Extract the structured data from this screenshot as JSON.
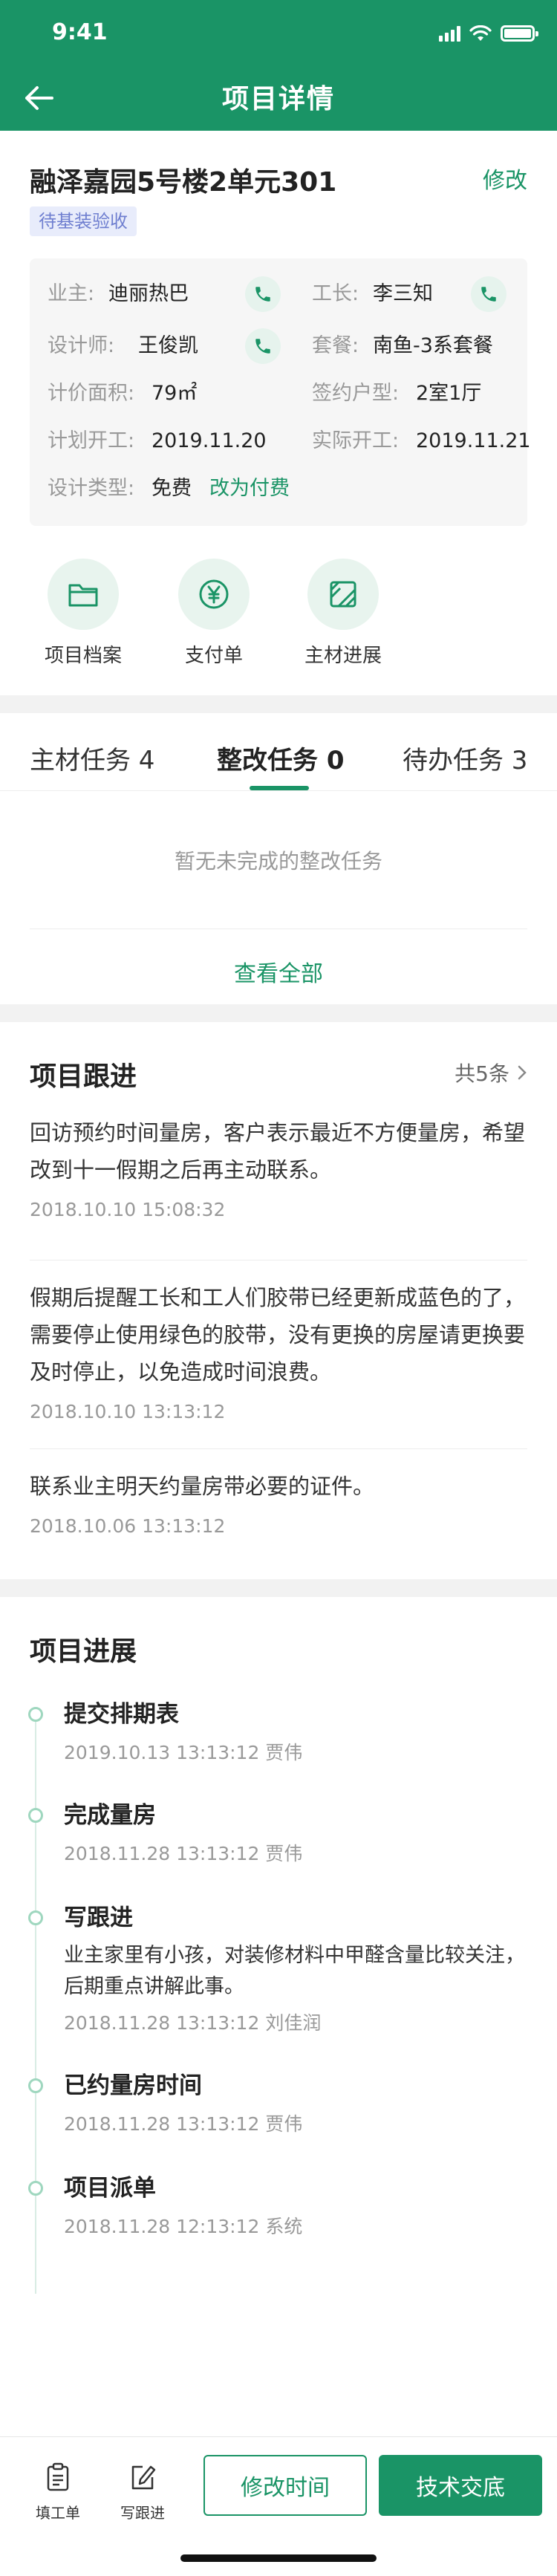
{
  "status_bar": {
    "time": "9:41"
  },
  "nav": {
    "title": "项目详情"
  },
  "project": {
    "name": "融泽嘉园5号楼2单元301",
    "edit_label": "修改",
    "status_tag": "待基装验收",
    "details": {
      "owner_label": "业主:",
      "owner_value": "迪丽热巴",
      "foreman_label": "工长:",
      "foreman_value": "李三知",
      "designer_label": "设计师:",
      "designer_value": "王俊凯",
      "package_label": "套餐:",
      "package_value": "南鱼-3系套餐",
      "area_label": "计价面积:",
      "area_value": "79㎡",
      "layout_label": "签约户型:",
      "layout_value": "2室1厅",
      "planned_start_label": "计划开工:",
      "planned_start_value": "2019.11.20",
      "actual_start_label": "实际开工:",
      "actual_start_value": "2019.11.21",
      "design_type_label": "设计类型:",
      "design_type_value": "免费",
      "change_to_paid": "改为付费"
    },
    "quick_actions": [
      {
        "label": "项目档案",
        "icon": "folder-icon"
      },
      {
        "label": "支付单",
        "icon": "yuan-icon"
      },
      {
        "label": "主材进展",
        "icon": "material-icon"
      }
    ]
  },
  "tasks": {
    "tabs": [
      {
        "label": "主材任务 4",
        "active": false
      },
      {
        "label": "整改任务 0",
        "active": true
      },
      {
        "label": "待办任务 3",
        "active": false
      }
    ],
    "empty_text": "暂无未完成的整改任务",
    "view_all": "查看全部"
  },
  "follow_up": {
    "title": "项目跟进",
    "count": "共5条",
    "items": [
      {
        "text": "回访预约时间量房，客户表示最近不方便量房，希望改到十一假期之后再主动联系。",
        "time": "2018.10.10 15:08:32"
      },
      {
        "text": "假期后提醒工长和工人们胶带已经更新成蓝色的了，需要停止使用绿色的胶带，没有更换的房屋请更换要及时停止，以免造成时间浪费。",
        "time": "2018.10.10 13:13:12"
      },
      {
        "text": "联系业主明天约量房带必要的证件。",
        "time": "2018.10.06 13:13:12"
      }
    ]
  },
  "progress": {
    "title": "项目进展",
    "items": [
      {
        "title": "提交排期表",
        "meta": "2019.10.13 13:13:12 贾伟"
      },
      {
        "title": "完成量房",
        "meta": "2018.11.28 13:13:12 贾伟"
      },
      {
        "title": "写跟进",
        "desc": "业主家里有小孩，对装修材料中甲醛含量比较关注，后期重点讲解此事。",
        "meta": "2018.11.28 13:13:12 刘佳润"
      },
      {
        "title": "已约量房时间",
        "meta": "2018.11.28 13:13:12 贾伟"
      },
      {
        "title": "项目派单",
        "meta": "2018.11.28 12:13:12 系统"
      }
    ]
  },
  "bottom_bar": {
    "fill_order": "填工单",
    "write_follow": "写跟进",
    "modify_time": "修改时间",
    "tech_handover": "技术交底"
  },
  "colors": {
    "brand": "#1a9466",
    "tag_bg": "#e8ecfb",
    "tag_text": "#6f7fd0"
  }
}
